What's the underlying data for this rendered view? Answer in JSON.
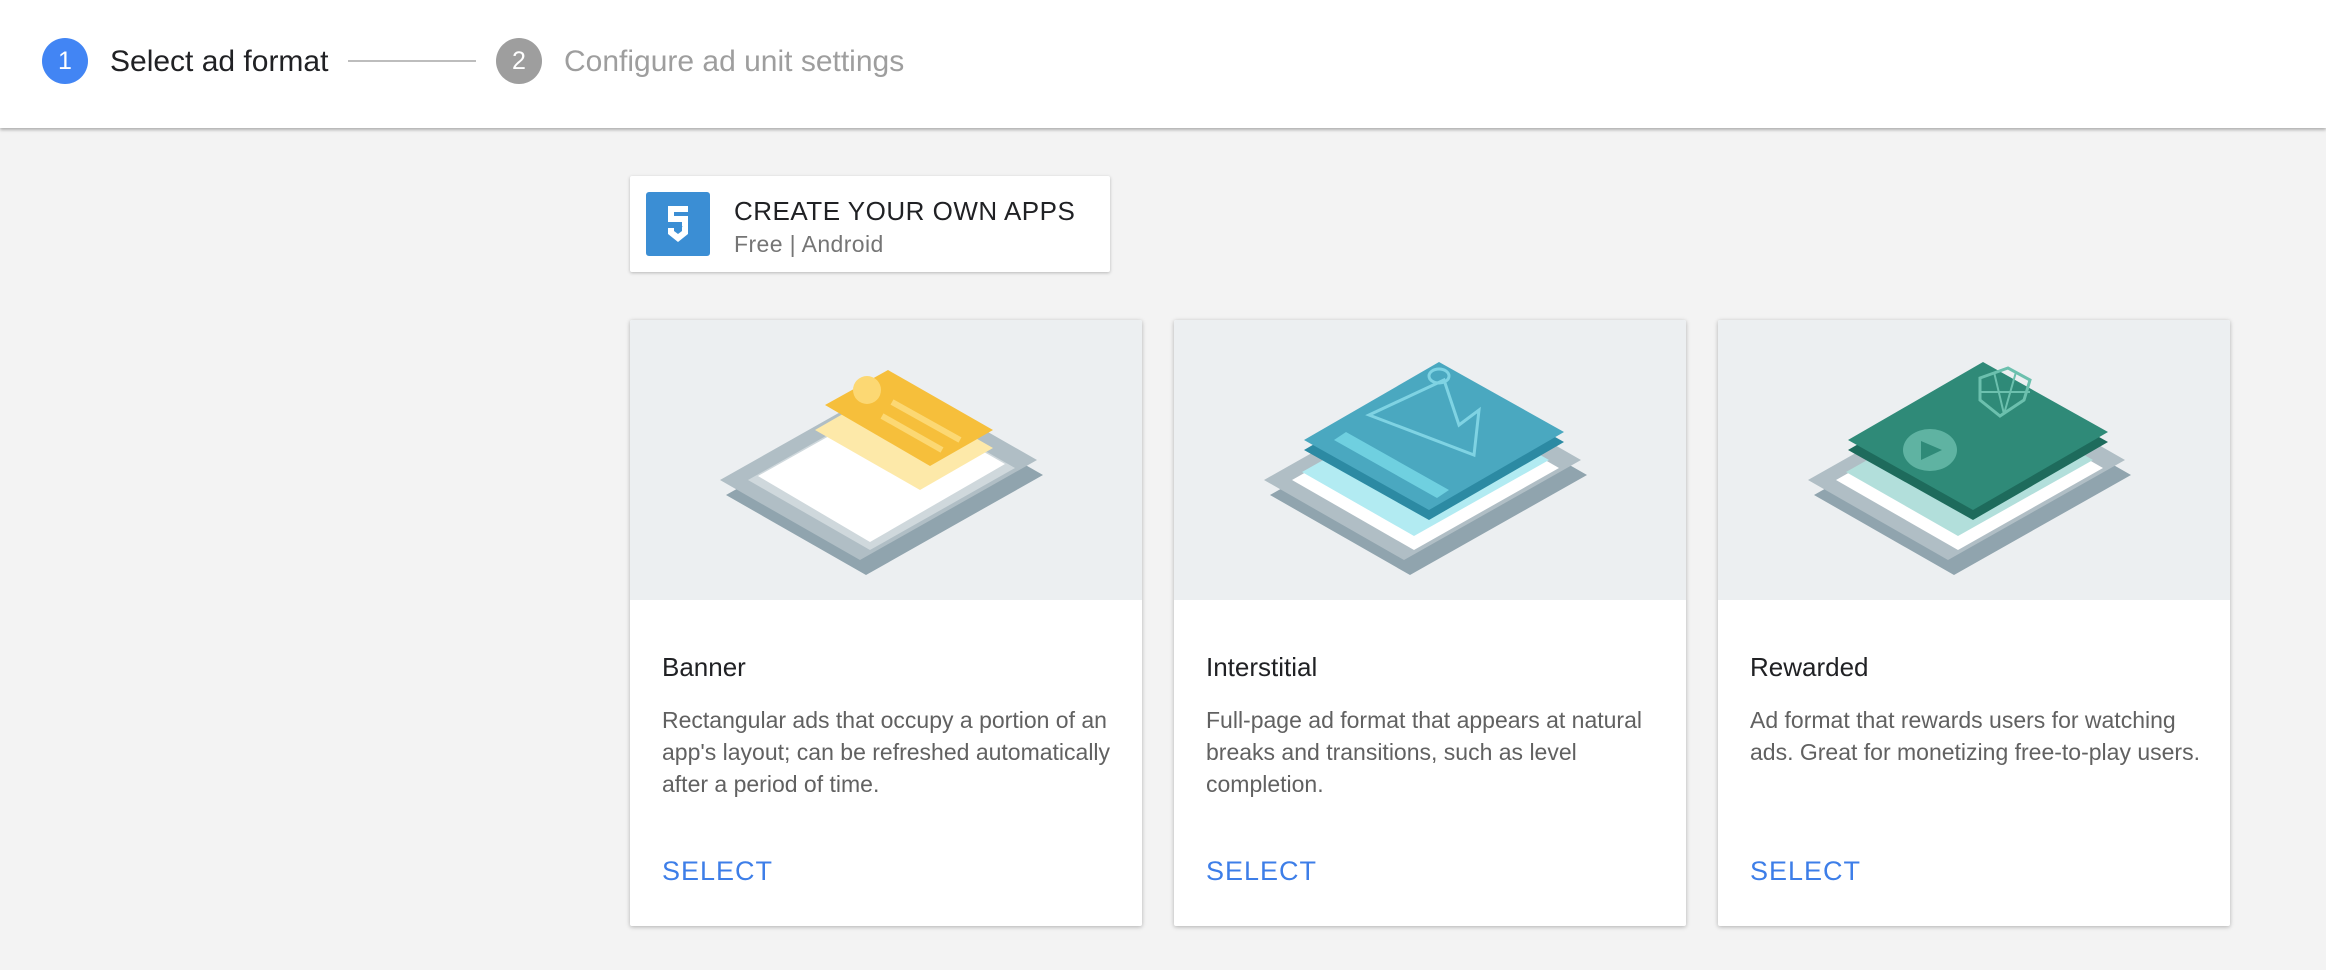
{
  "stepper": {
    "steps": [
      {
        "number": "1",
        "label": "Select ad format",
        "state": "active",
        "color": "#4285f4"
      },
      {
        "number": "2",
        "label": "Configure ad unit settings",
        "state": "inactive",
        "color": "#9e9e9e"
      }
    ]
  },
  "app": {
    "name": "CREATE YOUR OWN APPS",
    "meta": "Free | Android",
    "icon": "app-logo-icon",
    "icon_color": "#3b8ed4"
  },
  "formats": [
    {
      "id": "banner",
      "title": "Banner",
      "description": "Rectangular ads that occupy a portion of an app's layout; can be refreshed automatically after a period of time.",
      "action": "SELECT",
      "accent": "#f6bf3b",
      "illustration": "banner-illustration"
    },
    {
      "id": "interstitial",
      "title": "Interstitial",
      "description": "Full-page ad format that appears at natural breaks and transitions, such as level completion.",
      "action": "SELECT",
      "accent": "#4aa8c0",
      "illustration": "interstitial-illustration"
    },
    {
      "id": "rewarded",
      "title": "Rewarded",
      "description": "Ad format that rewards users for watching ads. Great for monetizing free-to-play users.",
      "action": "SELECT",
      "accent": "#2f8a78",
      "illustration": "rewarded-illustration"
    }
  ],
  "colors": {
    "page_background": "#f3f3f3",
    "link_blue": "#3d7ee8"
  }
}
